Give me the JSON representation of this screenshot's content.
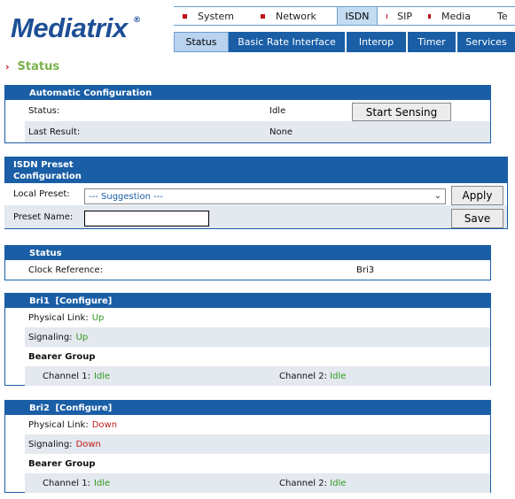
{
  "logo": {
    "text": "Mediatrix",
    "reg": "®"
  },
  "top_tabs": [
    {
      "label": "System"
    },
    {
      "label": "Network"
    },
    {
      "label": "ISDN"
    },
    {
      "label": "SIP"
    },
    {
      "label": "Media"
    },
    {
      "label": "Te"
    }
  ],
  "sub_tabs": [
    {
      "label": "Status"
    },
    {
      "label": "Basic Rate Interface"
    },
    {
      "label": "Interop"
    },
    {
      "label": "Timer"
    },
    {
      "label": "Services"
    }
  ],
  "page_title": "Status",
  "auto_config": {
    "header": "Automatic Configuration",
    "status_label": "Status:",
    "status_value": "Idle",
    "start_button": "Start Sensing",
    "last_result_label": "Last Result:",
    "last_result_value": "None"
  },
  "preset": {
    "header_line1": "ISDN Preset",
    "header_line2": "Configuration",
    "local_preset_label": "Local Preset:",
    "local_preset_value": "--- Suggestion ---",
    "apply_button": "Apply",
    "preset_name_label": "Preset Name:",
    "preset_name_value": "",
    "save_button": "Save"
  },
  "status_panel": {
    "header": "Status",
    "clock_label": "Clock Reference:",
    "clock_value": "Bri3"
  },
  "bri1": {
    "header": "Bri1",
    "configure": "[Configure]",
    "physical_link_label": "Physical Link:",
    "physical_link_value": "Up",
    "signaling_label": "Signaling:",
    "signaling_value": "Up",
    "bearer_group": "Bearer Group",
    "channel1_label": "Channel 1:",
    "channel1_value": "Idle",
    "channel2_label": "Channel 2:",
    "channel2_value": "Idle"
  },
  "bri2": {
    "header": "Bri2",
    "configure": "[Configure]",
    "physical_link_label": "Physical Link:",
    "physical_link_value": "Down",
    "signaling_label": "Signaling:",
    "signaling_value": "Down",
    "bearer_group": "Bearer Group",
    "channel1_label": "Channel 1:",
    "channel1_value": "Idle",
    "channel2_label": "Channel 2:",
    "channel2_value": "Idle"
  },
  "colors": {
    "brand_blue": "#1a5ea6",
    "title_green": "#7ab24a",
    "status_green": "#2e9a1e",
    "status_red": "#c01a1a",
    "bullet_red": "#c0101a"
  }
}
